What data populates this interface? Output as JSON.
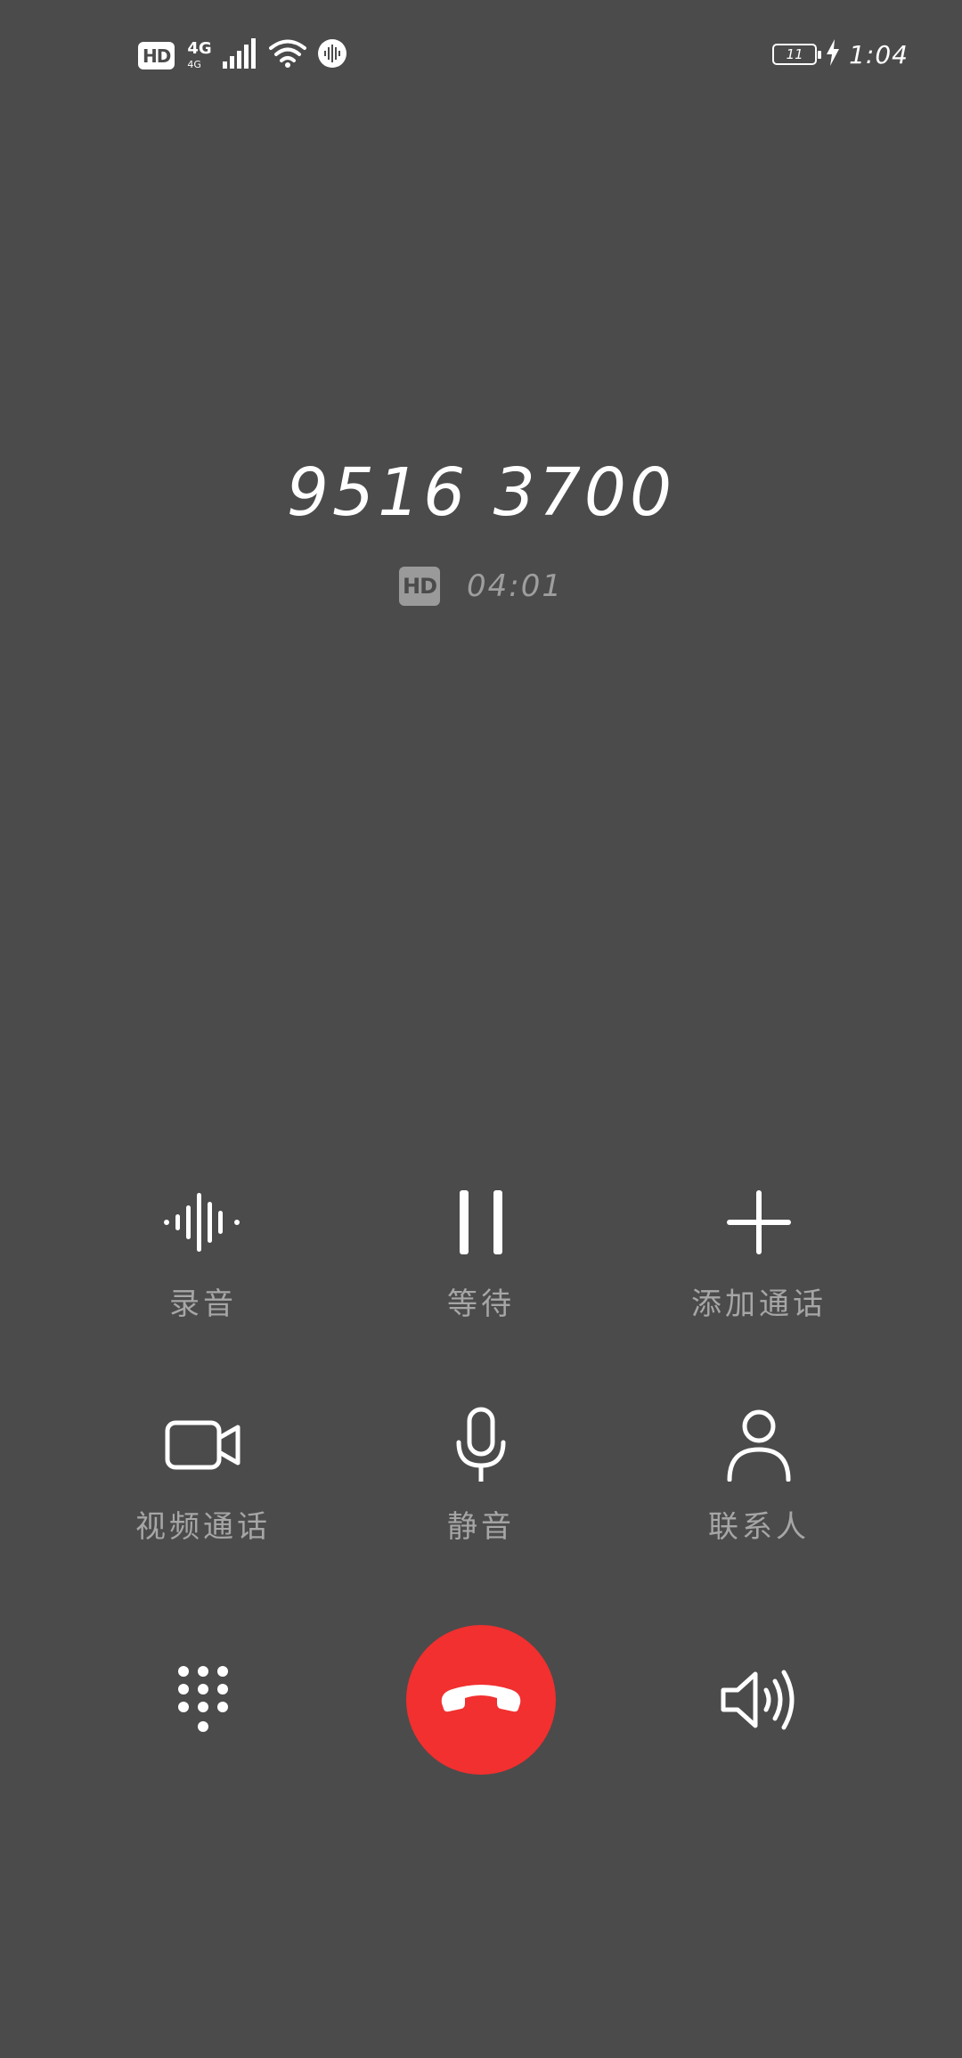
{
  "status_bar": {
    "hd": "HD",
    "network": "4G",
    "network_sub": "4G",
    "battery_level": "11",
    "time": "1:04"
  },
  "call": {
    "number": "9516 3700",
    "hd_badge": "HD",
    "duration": "04:01"
  },
  "controls": {
    "record": "录音",
    "hold": "等待",
    "add_call": "添加通话",
    "video_call": "视频通话",
    "mute": "静音",
    "contacts": "联系人"
  },
  "icons": {
    "keypad": "keypad-icon",
    "end_call": "end-call-icon",
    "speaker": "speaker-icon"
  },
  "colors": {
    "background": "#4b4b4b",
    "end_call": "#f1302f",
    "label": "#a6a6a6"
  }
}
